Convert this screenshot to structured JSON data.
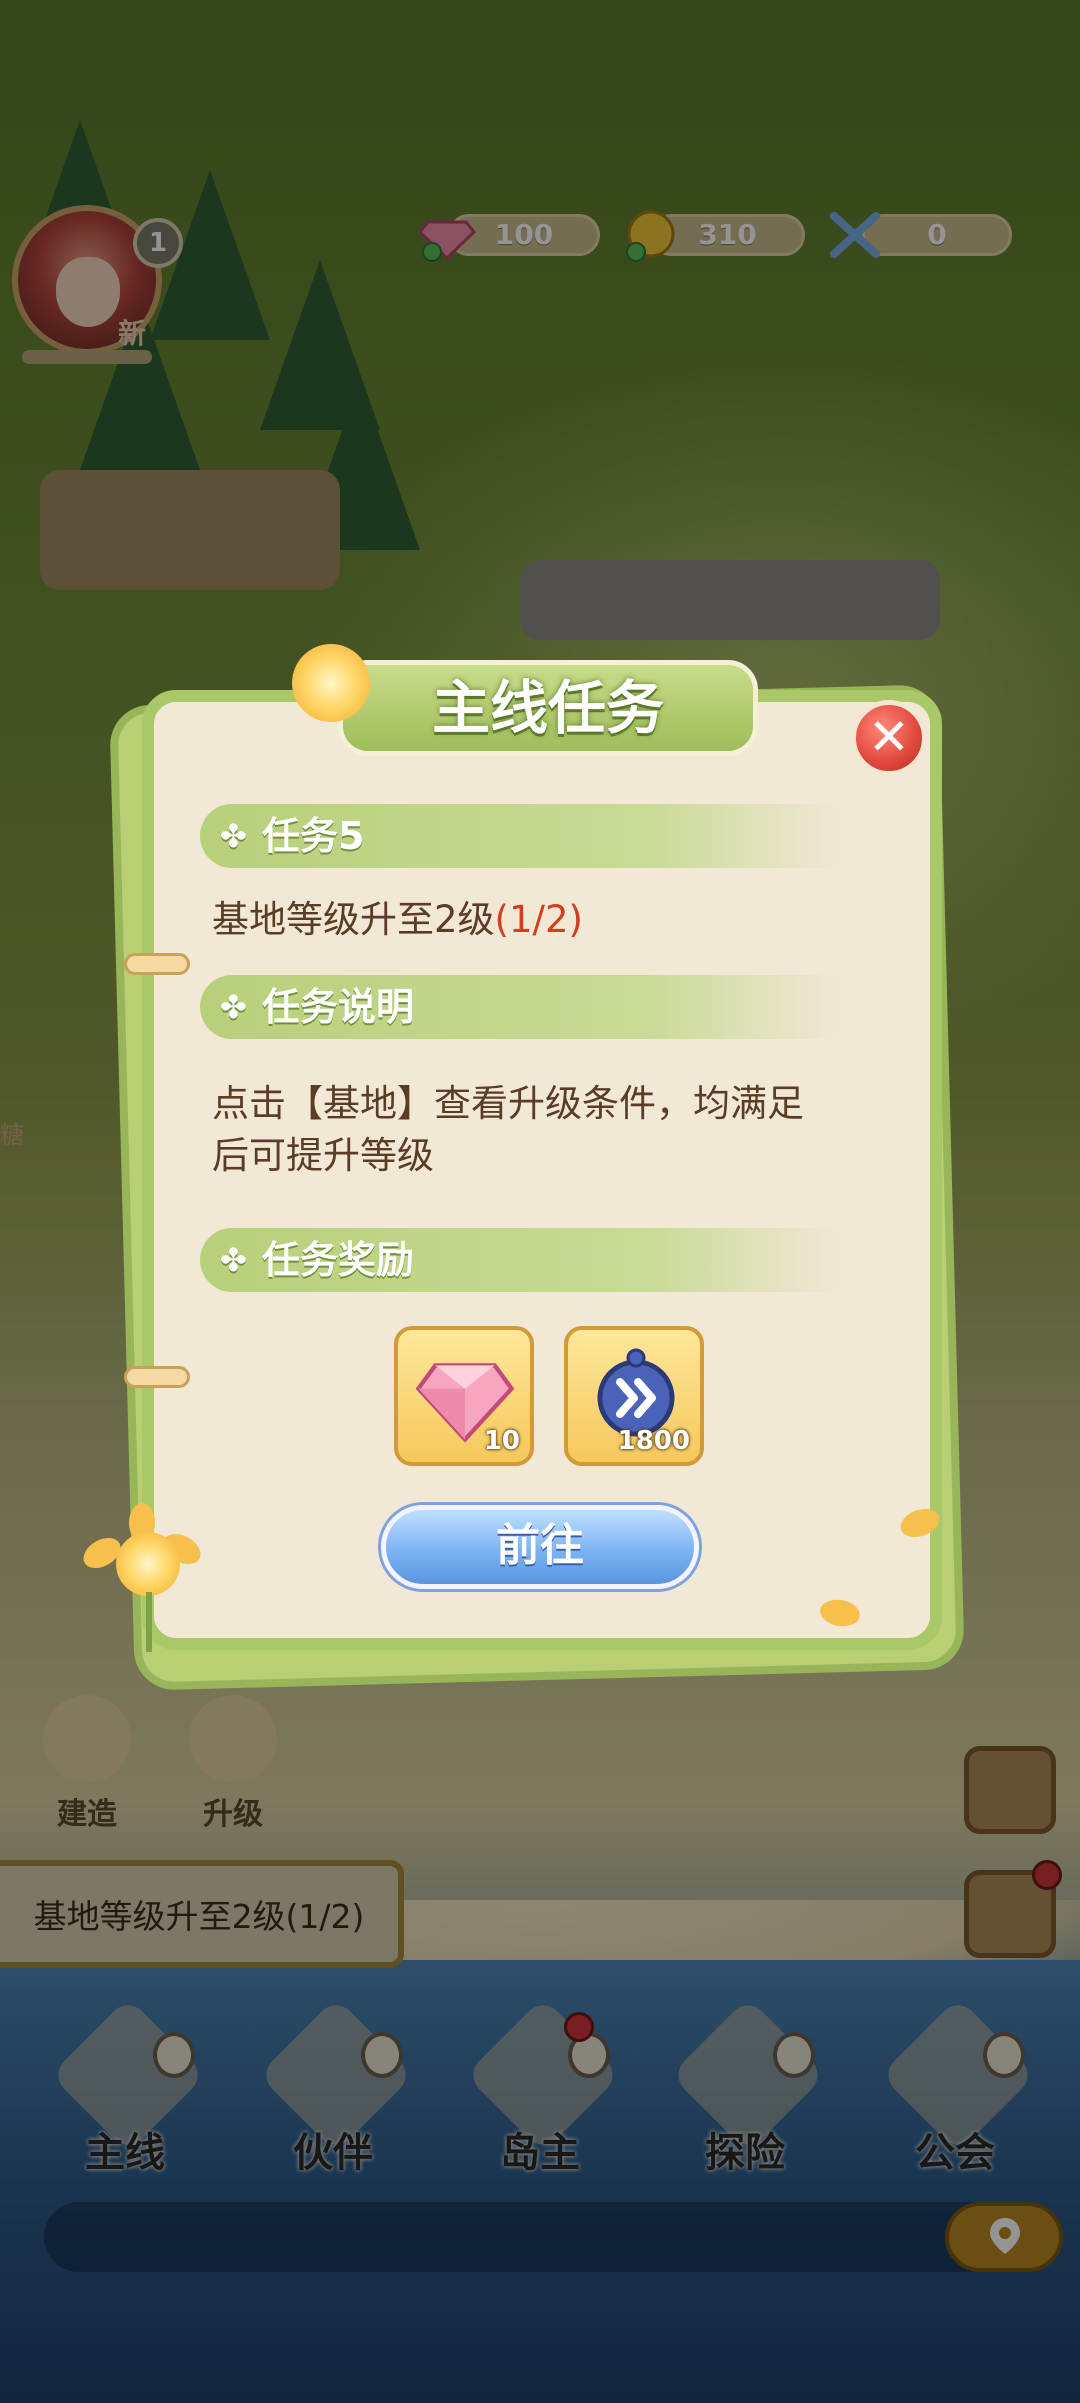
{
  "hud": {
    "level": "1",
    "new_tag": "新",
    "gems": "100",
    "coins": "310",
    "swords": "0",
    "icons": {
      "gem": "gem-icon",
      "coin": "coin-icon",
      "sword": "crossed-swords-icon"
    }
  },
  "side_buttons": {
    "build": "建造",
    "upgrade": "升级"
  },
  "task_banner": "基地等级升至2级(1/2)",
  "left_edge_text": "糖",
  "nav": {
    "items": [
      "主线",
      "伙伴",
      "岛主",
      "探险",
      "公会"
    ]
  },
  "modal": {
    "title": "主线任务",
    "task_heading": "任务5",
    "task_text": "基地等级升至2级",
    "task_progress": "(1/2)",
    "desc_heading": "任务说明",
    "desc_line1": "点击【基地】查看升级条件，均满足",
    "desc_line2": "后可提升等级",
    "reward_heading": "任务奖励",
    "rewards": [
      {
        "icon": "pink-gem-icon",
        "count": "10"
      },
      {
        "icon": "speedup-clock-icon",
        "count": "1800"
      }
    ],
    "go_button": "前往"
  },
  "colors": {
    "modal_border": "#a9c868",
    "progress_red": "#d63c1e",
    "go_button": "#7cb3f2"
  }
}
